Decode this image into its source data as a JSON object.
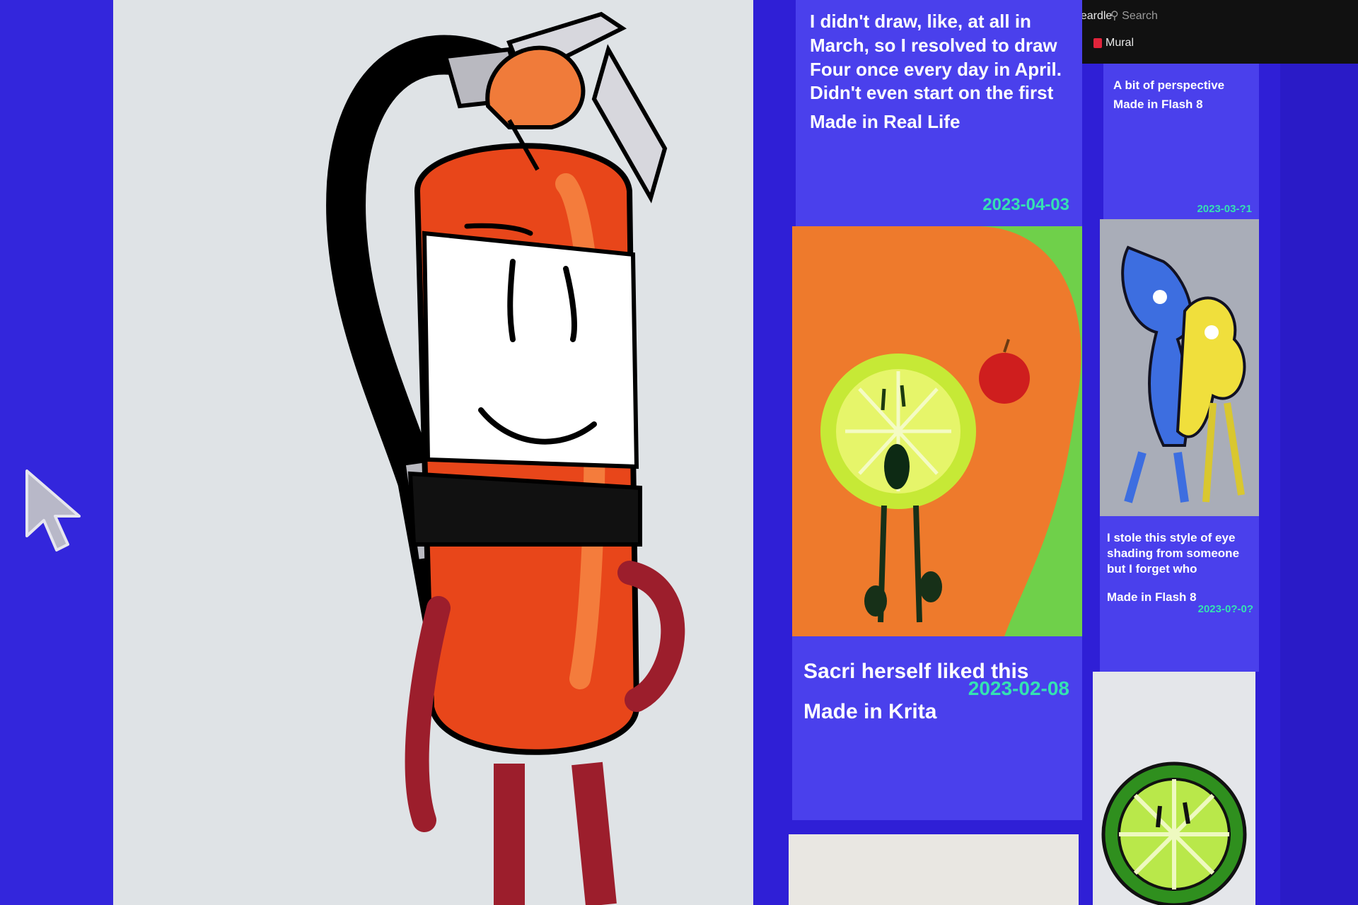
{
  "browser_tabs": [
    {
      "label": "Weezer Heardle",
      "icon": "page-icon",
      "color": "#777777"
    },
    {
      "label": "Mural",
      "icon": "mural-icon",
      "color": "#e0243b"
    }
  ],
  "search": {
    "label": "Search"
  },
  "featured": {
    "title": "",
    "colors": {
      "body": "#e8461a",
      "label": "#ffffff",
      "outline": "#000000",
      "limbs": "#9c1e2c"
    }
  },
  "cards": [
    {
      "desc": "I didn't draw, like, at all in March, so I resolved to draw Four once every day in April. Didn't even start on the first",
      "made_prefix": "Made in",
      "made_tool": "Real Life",
      "date": "2023-04-03"
    },
    {
      "desc": "A bit of perspective",
      "made_prefix": "Made in",
      "made_tool": "Flash 8",
      "date": "2023-03-?1"
    },
    {
      "desc": "Sacri herself liked this",
      "made_prefix": "Made in",
      "made_tool": "Krita",
      "date": "2023-02-08"
    },
    {
      "desc": "I stole this style of eye shading from someone but I forget who",
      "made_prefix": "Made in",
      "made_tool": "Flash 8",
      "date": "2023-0?-0?"
    }
  ],
  "colors": {
    "page_bg": "#2f1fd6",
    "card_bg": "#4a40ec",
    "date": "#35e1b2",
    "text": "#ffffff"
  }
}
